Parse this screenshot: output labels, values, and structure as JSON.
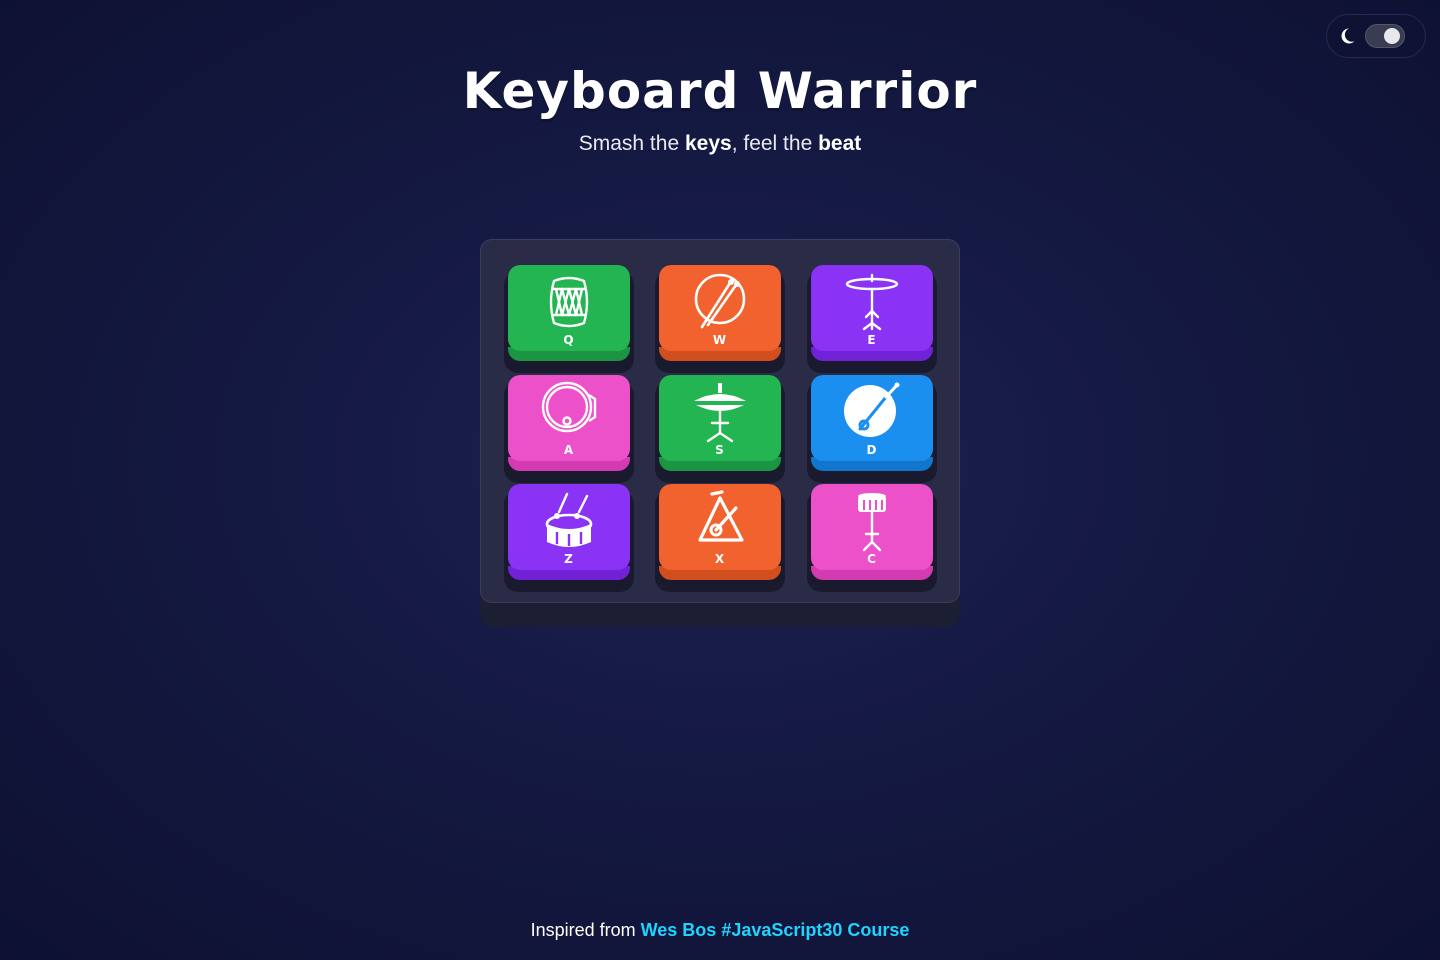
{
  "app": {
    "title": "Keyboard Warrior",
    "subtitle": {
      "t1": "Smash the ",
      "b1": "keys",
      "t2": ", feel the ",
      "b2": "beat"
    }
  },
  "theme_toggle": {
    "icon": "moon-icon",
    "state": "on"
  },
  "pads": [
    {
      "key": "Q",
      "icon": "dhol-icon",
      "color": "#22b551",
      "lip": "#1b9443"
    },
    {
      "key": "W",
      "icon": "drum-sticks-icon",
      "color": "#f1622f",
      "lip": "#d14e1f"
    },
    {
      "key": "E",
      "icon": "cymbal-stand-icon",
      "color": "#8a33f4",
      "lip": "#7222d6"
    },
    {
      "key": "A",
      "icon": "bass-drum-icon",
      "color": "#ec51c9",
      "lip": "#d33bb1"
    },
    {
      "key": "S",
      "icon": "hi-hat-icon",
      "color": "#22b551",
      "lip": "#1b9443"
    },
    {
      "key": "D",
      "icon": "tom-drum-icon",
      "color": "#1b8ff0",
      "lip": "#1276cf"
    },
    {
      "key": "Z",
      "icon": "snare-drum-icon",
      "color": "#8a33f4",
      "lip": "#7222d6"
    },
    {
      "key": "X",
      "icon": "triangle-icon",
      "color": "#f1622f",
      "lip": "#d14e1f"
    },
    {
      "key": "C",
      "icon": "snare-stand-icon",
      "color": "#ec51c9",
      "lip": "#d33bb1"
    }
  ],
  "footer": {
    "prefix": "Inspired from ",
    "link": "Wes Bos #JavaScript30 Course"
  }
}
